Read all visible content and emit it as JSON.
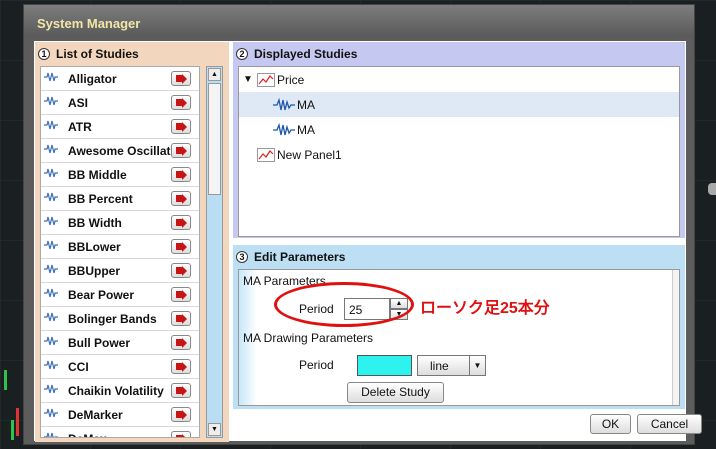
{
  "window": {
    "title": "System Manager"
  },
  "studies_panel": {
    "number": "1",
    "title": "List of Studies",
    "items": [
      "Alligator",
      "ASI",
      "ATR",
      "Awesome Oscillator",
      "BB Middle",
      "BB Percent",
      "BB Width",
      "BBLower",
      "BBUpper",
      "Bear Power",
      "Bolinger Bands",
      "Bull Power",
      "CCI",
      "Chaikin Volatility",
      "DeMarker",
      "DeMax"
    ]
  },
  "displayed_panel": {
    "number": "2",
    "title": "Displayed Studies",
    "tree": [
      {
        "label": "Price",
        "kind": "chart",
        "expanded": true
      },
      {
        "label": "MA",
        "kind": "wave",
        "selected": true
      },
      {
        "label": "MA",
        "kind": "wave"
      },
      {
        "label": "New Panel1",
        "kind": "chart"
      }
    ]
  },
  "edit_panel": {
    "number": "3",
    "title": "Edit Parameters",
    "params_heading": "MA Parameters",
    "period_label": "Period",
    "period_value": "25",
    "drawing_heading": "MA Drawing Parameters",
    "drawing_period_label": "Period",
    "line_color": "#2ef2ee",
    "line_style": "line",
    "delete_label": "Delete Study"
  },
  "annotation": {
    "text": "ローソク足25本分",
    "color": "#e01010"
  },
  "buttons": {
    "ok": "OK",
    "cancel": "Cancel"
  }
}
